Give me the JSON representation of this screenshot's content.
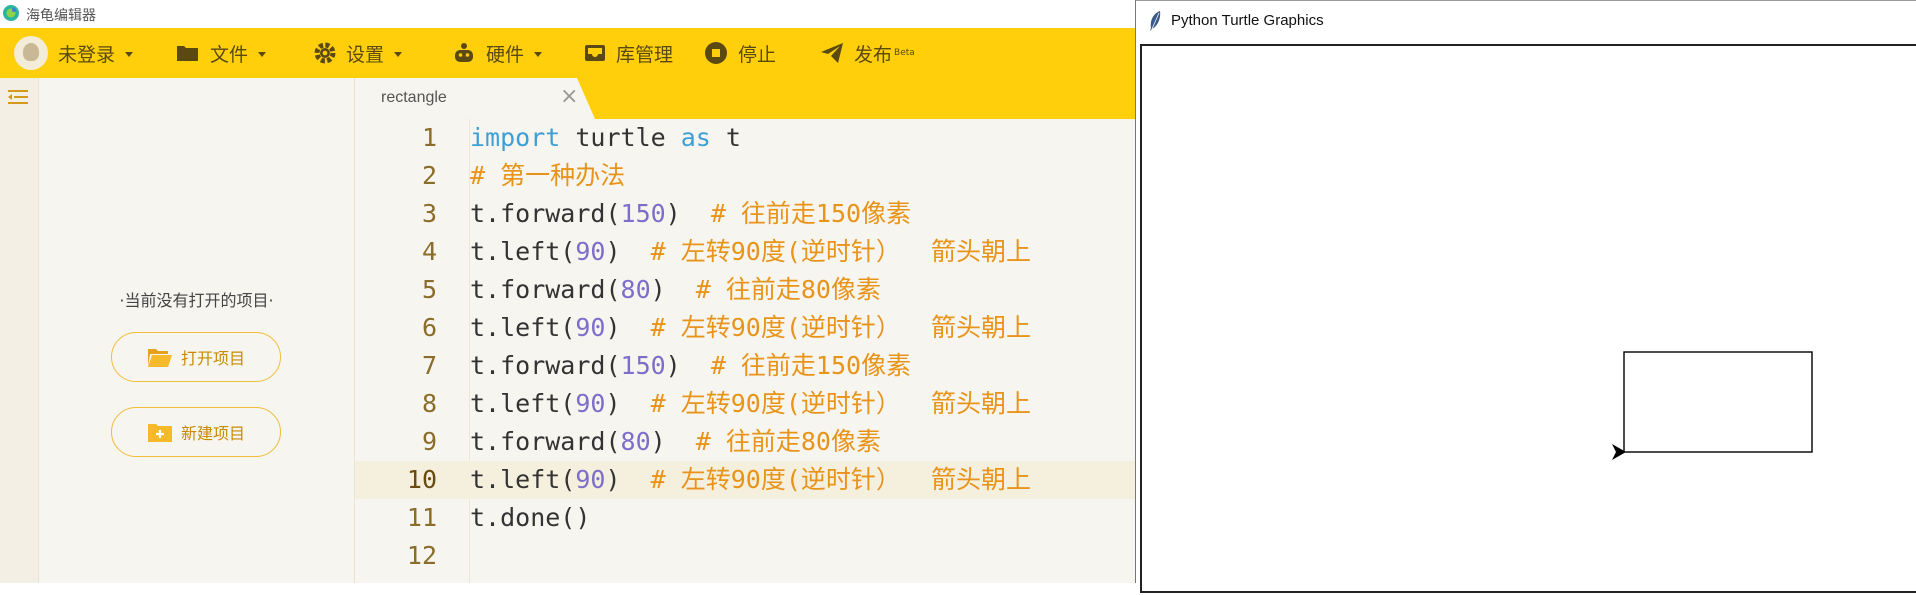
{
  "app": {
    "title": "海龟编辑器"
  },
  "toolbar": {
    "user": "未登录",
    "file": "文件",
    "settings": "设置",
    "hardware": "硬件",
    "library": "库管理",
    "stop": "停止",
    "publish": "发布",
    "publish_badge": "Beta",
    "accent_color": "#ffcf0b"
  },
  "sidebar": {
    "empty_message": "·当前没有打开的项目·",
    "open_project": "打开项目",
    "new_project": "新建项目"
  },
  "editor": {
    "tab_name": "rectangle",
    "active_line": 10,
    "lines": [
      {
        "n": "1",
        "code": "import turtle as t"
      },
      {
        "n": "2",
        "code": "# 第一种办法"
      },
      {
        "n": "3",
        "code": "t.forward(150)  # 往前走150像素"
      },
      {
        "n": "4",
        "code": "t.left(90)  # 左转90度(逆时针）  箭头朝上"
      },
      {
        "n": "5",
        "code": "t.forward(80)  # 往前走80像素"
      },
      {
        "n": "6",
        "code": "t.left(90)  # 左转90度(逆时针）  箭头朝上"
      },
      {
        "n": "7",
        "code": "t.forward(150)  # 往前走150像素"
      },
      {
        "n": "8",
        "code": "t.left(90)  # 左转90度(逆时针）  箭头朝上"
      },
      {
        "n": "9",
        "code": "t.forward(80)  # 往前走80像素"
      },
      {
        "n": "10",
        "code": "t.left(90)  # 左转90度(逆时针）  箭头朝上"
      },
      {
        "n": "11",
        "code": "t.done()"
      },
      {
        "n": "12",
        "code": ""
      }
    ]
  },
  "turtle_window": {
    "title": "Python Turtle Graphics"
  }
}
